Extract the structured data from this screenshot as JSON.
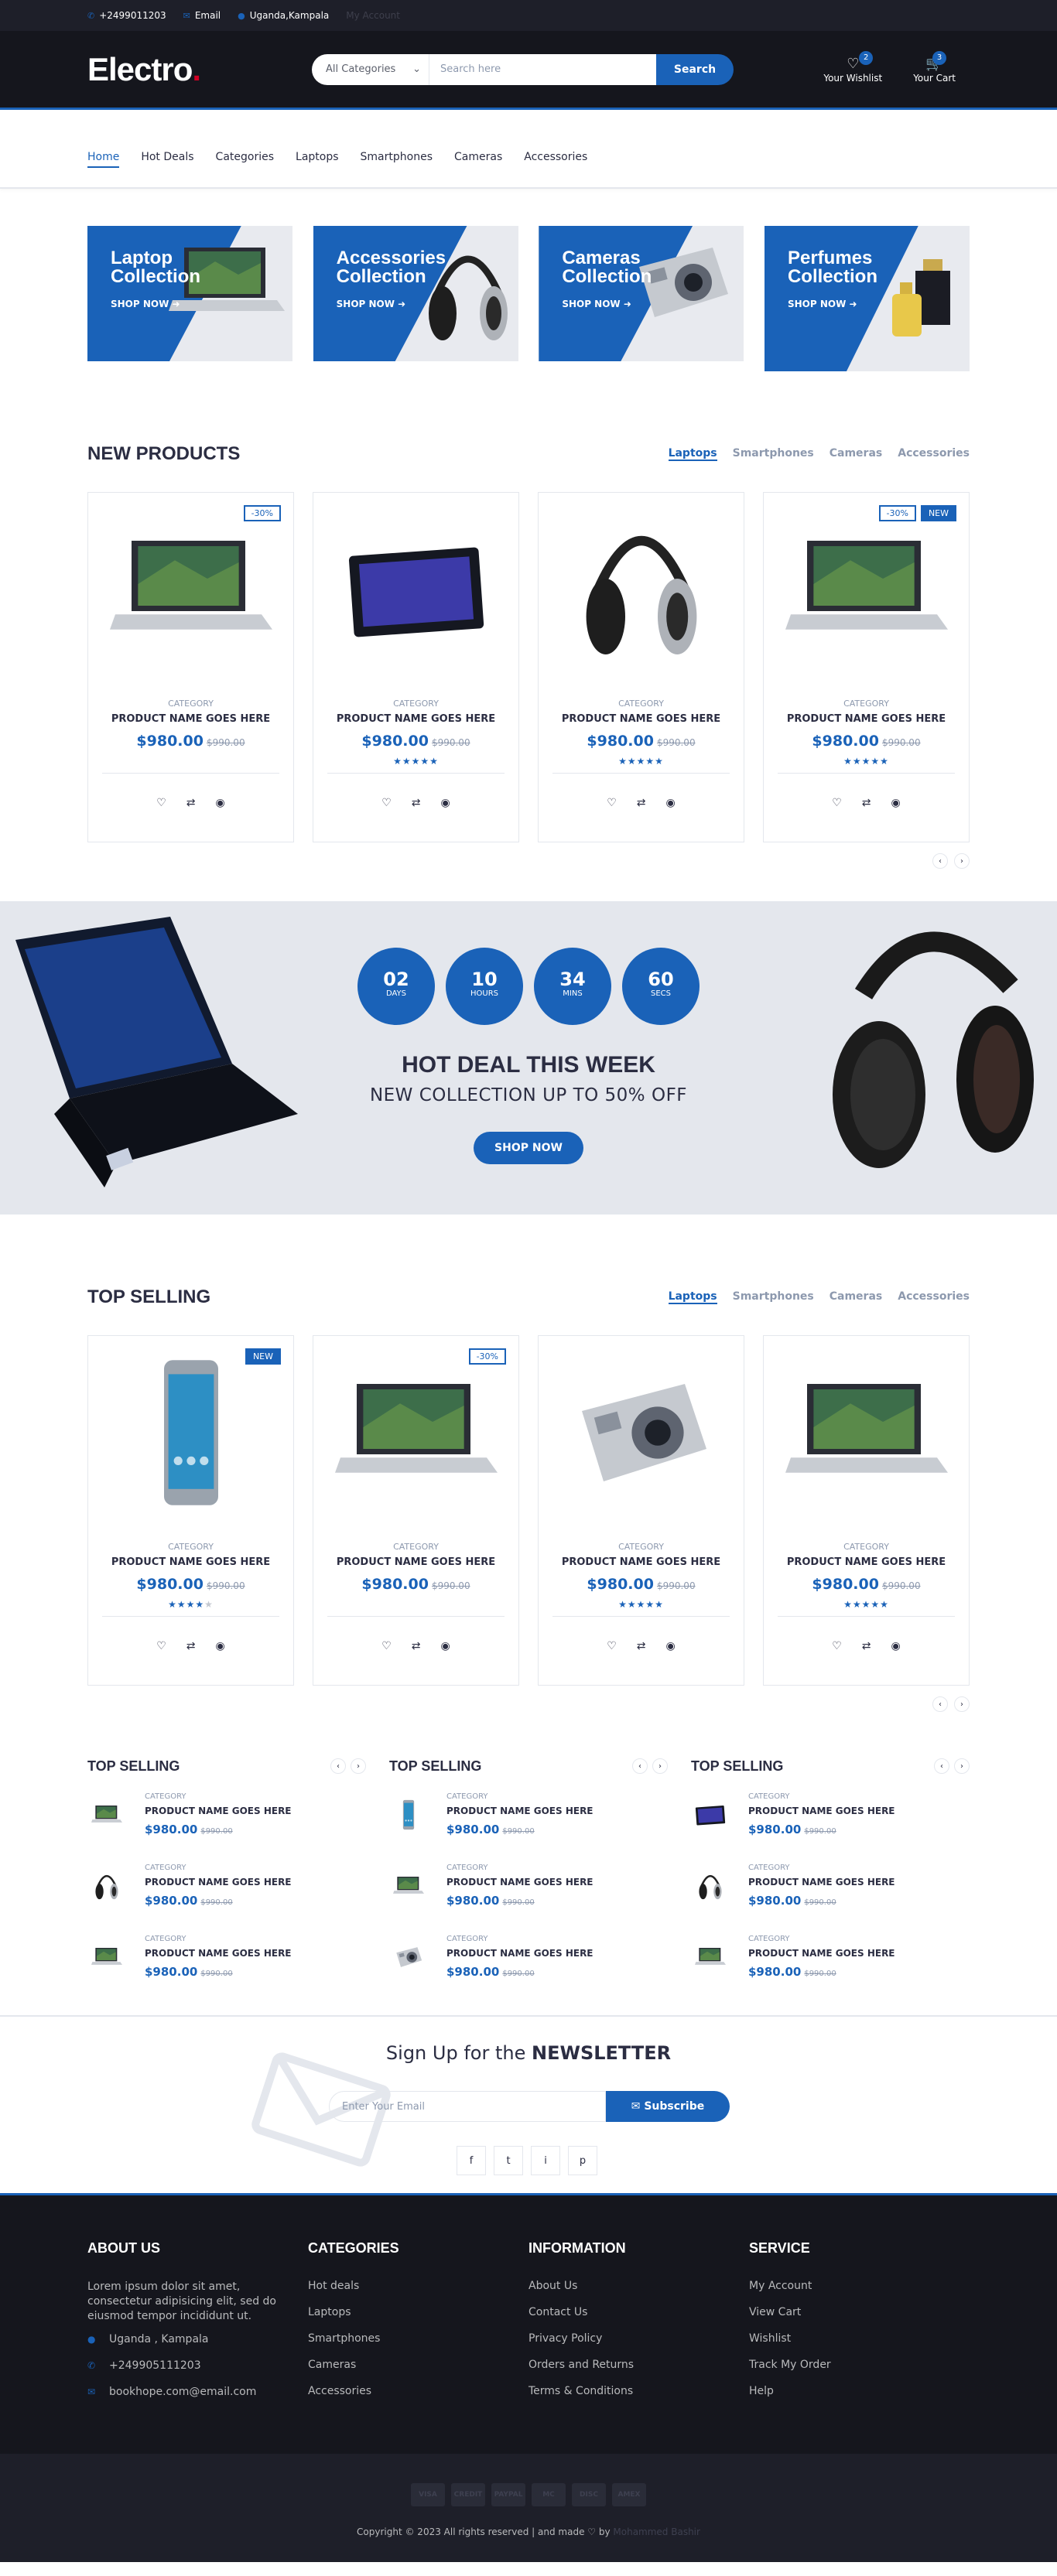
{
  "topbar": {
    "phone": "+2499011203",
    "email": "Email",
    "location": "Uganda,Kampala",
    "account": "My Account"
  },
  "header": {
    "logo": "Electro",
    "logo_dot": ".",
    "category_select": "All Categories",
    "search_placeholder": "Search here",
    "search_button": "Search",
    "wishlist_label": "Your Wishlist",
    "wishlist_count": "2",
    "cart_label": "Your Cart",
    "cart_count": "3"
  },
  "nav": [
    "Home",
    "Hot Deals",
    "Categories",
    "Laptops",
    "Smartphones",
    "Cameras",
    "Accessories"
  ],
  "collections": [
    {
      "title": "Laptop Collection",
      "cta": "SHOP NOW",
      "icon": "laptop"
    },
    {
      "title": "Accessories Collection",
      "cta": "SHOP NOW",
      "icon": "headphones"
    },
    {
      "title": "Cameras Collection",
      "cta": "SHOP NOW",
      "icon": "camera"
    },
    {
      "title": "Perfumes Collection",
      "cta": "SHOP NOW",
      "icon": "perfume"
    }
  ],
  "new_products": {
    "title": "NEW PRODUCTS",
    "tabs": [
      "Laptops",
      "Smartphones",
      "Cameras",
      "Accessories"
    ],
    "items": [
      {
        "labels": [
          "-30%"
        ],
        "category": "CATEGORY",
        "name": "PRODUCT NAME GOES HERE",
        "price": "$980.00",
        "old_price": "$990.00",
        "rating": 0,
        "icon": "laptop"
      },
      {
        "labels": [],
        "category": "CATEGORY",
        "name": "PRODUCT NAME GOES HERE",
        "price": "$980.00",
        "old_price": "$990.00",
        "rating": 5,
        "icon": "tablet"
      },
      {
        "labels": [],
        "category": "CATEGORY",
        "name": "PRODUCT NAME GOES HERE",
        "price": "$980.00",
        "old_price": "$990.00",
        "rating": 5,
        "icon": "headphones"
      },
      {
        "labels": [
          "-30%",
          "NEW"
        ],
        "category": "CATEGORY",
        "name": "PRODUCT NAME GOES HERE",
        "price": "$980.00",
        "old_price": "$990.00",
        "rating": 5,
        "icon": "laptop"
      }
    ]
  },
  "hot_deal": {
    "counters": [
      {
        "value": "02",
        "unit": "DAYS"
      },
      {
        "value": "10",
        "unit": "HOURS"
      },
      {
        "value": "34",
        "unit": "MINS"
      },
      {
        "value": "60",
        "unit": "SECS"
      }
    ],
    "title": "HOT DEAL THIS WEEK",
    "subtitle": "NEW COLLECTION UP TO 50% OFF",
    "cta": "SHOP NOW"
  },
  "top_selling": {
    "title": "TOP SELLING",
    "tabs": [
      "Laptops",
      "Smartphones",
      "Cameras",
      "Accessories"
    ],
    "items": [
      {
        "labels": [
          "NEW"
        ],
        "category": "CATEGORY",
        "name": "PRODUCT NAME GOES HERE",
        "price": "$980.00",
        "old_price": "$990.00",
        "rating": 4,
        "icon": "phone"
      },
      {
        "labels": [
          "-30%"
        ],
        "category": "CATEGORY",
        "name": "PRODUCT NAME GOES HERE",
        "price": "$980.00",
        "old_price": "$990.00",
        "rating": 0,
        "icon": "laptop"
      },
      {
        "labels": [],
        "category": "CATEGORY",
        "name": "PRODUCT NAME GOES HERE",
        "price": "$980.00",
        "old_price": "$990.00",
        "rating": 5,
        "icon": "camera"
      },
      {
        "labels": [],
        "category": "CATEGORY",
        "name": "PRODUCT NAME GOES HERE",
        "price": "$980.00",
        "old_price": "$990.00",
        "rating": 5,
        "icon": "laptop"
      }
    ]
  },
  "widgets": [
    {
      "title": "TOP SELLING",
      "items": [
        {
          "category": "CATEGORY",
          "name": "PRODUCT NAME GOES HERE",
          "price": "$980.00",
          "old_price": "$990.00",
          "icon": "laptop"
        },
        {
          "category": "CATEGORY",
          "name": "PRODUCT NAME GOES HERE",
          "price": "$980.00",
          "old_price": "$990.00",
          "icon": "headphones"
        },
        {
          "category": "CATEGORY",
          "name": "PRODUCT NAME GOES HERE",
          "price": "$980.00",
          "old_price": "$990.00",
          "icon": "laptop"
        }
      ]
    },
    {
      "title": "TOP SELLING",
      "items": [
        {
          "category": "CATEGORY",
          "name": "PRODUCT NAME GOES HERE",
          "price": "$980.00",
          "old_price": "$990.00",
          "icon": "phone"
        },
        {
          "category": "CATEGORY",
          "name": "PRODUCT NAME GOES HERE",
          "price": "$980.00",
          "old_price": "$990.00",
          "icon": "laptop"
        },
        {
          "category": "CATEGORY",
          "name": "PRODUCT NAME GOES HERE",
          "price": "$980.00",
          "old_price": "$990.00",
          "icon": "camera"
        }
      ]
    },
    {
      "title": "TOP SELLING",
      "items": [
        {
          "category": "CATEGORY",
          "name": "PRODUCT NAME GOES HERE",
          "price": "$980.00",
          "old_price": "$990.00",
          "icon": "tablet"
        },
        {
          "category": "CATEGORY",
          "name": "PRODUCT NAME GOES HERE",
          "price": "$980.00",
          "old_price": "$990.00",
          "icon": "headphones"
        },
        {
          "category": "CATEGORY",
          "name": "PRODUCT NAME GOES HERE",
          "price": "$980.00",
          "old_price": "$990.00",
          "icon": "laptop"
        }
      ]
    }
  ],
  "newsletter": {
    "lead": "Sign Up for the ",
    "strong": "NEWSLETTER",
    "placeholder": "Enter Your Email",
    "button": "Subscribe",
    "socials": [
      "f",
      "t",
      "i",
      "p"
    ]
  },
  "footer": {
    "about": {
      "title": "ABOUT US",
      "text": "Lorem ipsum dolor sit amet, consectetur adipisicing elit, sed do eiusmod tempor incididunt ut.",
      "address": "Uganda , Kampala",
      "phone": "+249905111203",
      "email": "bookhope.com@email.com"
    },
    "categories": {
      "title": "CATEGORIES",
      "links": [
        "Hot deals",
        "Laptops",
        "Smartphones",
        "Cameras",
        "Accessories"
      ]
    },
    "information": {
      "title": "INFORMATION",
      "links": [
        "About Us",
        "Contact Us",
        "Privacy Policy",
        "Orders and Returns",
        "Terms & Conditions"
      ]
    },
    "service": {
      "title": "SERVICE",
      "links": [
        "My Account",
        "View Cart",
        "Wishlist",
        "Track My Order",
        "Help"
      ]
    },
    "payment_cards": [
      "VISA",
      "CREDIT",
      "PAYPAL",
      "MC",
      "DISC",
      "AMEX"
    ],
    "copyright": "Copyright © 2023 All rights reserved | and made ♡ by",
    "credit": "Mohammed Bashir"
  },
  "colors": {
    "accent": "#1a62b8",
    "dark": "#15161d",
    "darker": "#1e1f29",
    "light": "#e4e7ed",
    "logo_dot": "#d10024"
  }
}
